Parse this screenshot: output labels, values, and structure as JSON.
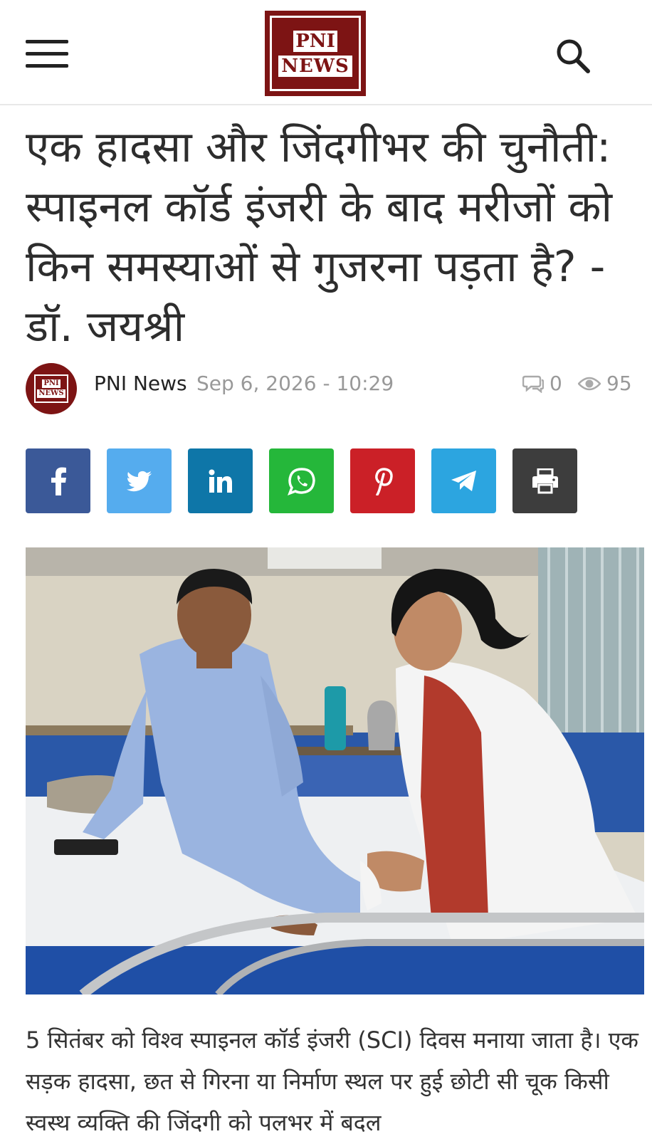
{
  "header": {
    "logo_line1": "PNI",
    "logo_line2": "NEWS"
  },
  "article": {
    "title": "एक हादसा और जिंदगीभर की चुनौती: स्पाइनल कॉर्ड इंजरी के बाद मरीजों को किन समस्याओं से गुजरना पड़ता है? - डॉ. जयश्री",
    "author": "PNI News",
    "date": "Sep 6, 2026 - 10:29",
    "comments": "0",
    "views": "95",
    "body": "5 सितंबर को विश्व स्पाइनल कॉर्ड इंजरी (SCI) दिवस मनाया जाता है। एक सड़क हादसा, छत से गिरना या निर्माण स्थल पर हुई छोटी सी चूक किसी स्वस्थ व्यक्ति की जिंदगी को पलभर में बदल"
  },
  "share_buttons": [
    {
      "name": "facebook",
      "color": "#3b5998"
    },
    {
      "name": "twitter",
      "color": "#55acee"
    },
    {
      "name": "linkedin",
      "color": "#0e76a8"
    },
    {
      "name": "whatsapp",
      "color": "#25b73a"
    },
    {
      "name": "pinterest",
      "color": "#cb2027"
    },
    {
      "name": "telegram",
      "color": "#2ca5e0"
    },
    {
      "name": "print",
      "color": "#3d3d3d"
    }
  ],
  "colors": {
    "brand": "#7d1414",
    "meta_text": "#999999"
  },
  "icons": [
    "menu-icon",
    "search-icon",
    "comment-icon",
    "eye-icon"
  ]
}
